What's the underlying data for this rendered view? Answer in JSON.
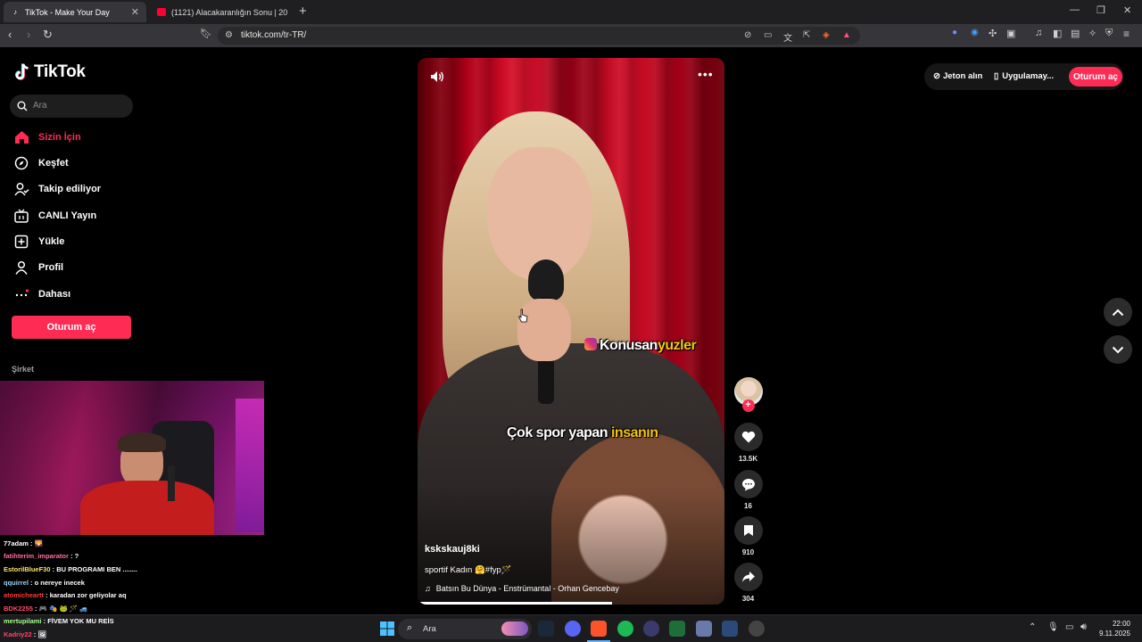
{
  "browser": {
    "tabs": [
      {
        "title": "TikTok - Make Your Day",
        "active": true
      },
      {
        "title": "(1121) Alacakaranlığın Sonu | 2025 3...",
        "active": false
      }
    ],
    "url": "tiktok.com/tr-TR/"
  },
  "tiktok": {
    "logo": "TikTok",
    "search_placeholder": "Ara",
    "nav": [
      {
        "label": "Sizin İçin",
        "icon": "home-icon",
        "active": true
      },
      {
        "label": "Keşfet",
        "icon": "compass-icon"
      },
      {
        "label": "Takip ediliyor",
        "icon": "following-icon"
      },
      {
        "label": "CANLI Yayın",
        "icon": "live-tv-icon"
      },
      {
        "label": "Yükle",
        "icon": "upload-icon"
      },
      {
        "label": "Profil",
        "icon": "profile-icon"
      },
      {
        "label": "Dahası",
        "icon": "more-icon"
      }
    ],
    "login_button": "Oturum aç",
    "company_label": "Şirket",
    "top_right": {
      "coins": "Jeton alın",
      "app": "Uygulamay...",
      "login": "Oturum aç"
    },
    "video": {
      "subtitle_1_white": "Konusan",
      "subtitle_1_yellow": "yuzler",
      "subtitle_2_white": "Çok spor yapan ",
      "subtitle_2_yellow": "insanın",
      "username": "kskskauj8ki",
      "description": "sportif Kadın 🤗#fyp🪄",
      "music": "Batsın Bu Dünya - Enstrümantal - Orhan Gencebay",
      "likes": "13.5K",
      "comments": "16",
      "saves": "910",
      "shares": "304"
    }
  },
  "chat": [
    {
      "user": "77adam",
      "msg": "🌄",
      "color": "#ffffff"
    },
    {
      "user": "fatihterim_imparator",
      "msg": "?",
      "color": "#ff6fa0"
    },
    {
      "user": "EstorilBlueF30",
      "msg": "BU PROGRAMI BEN ........",
      "color": "#ffe26b"
    },
    {
      "user": "qquirrel",
      "msg": "o nereye inecek",
      "color": "#9ad7ff"
    },
    {
      "user": "atomicheartt",
      "msg": "karadan zor geliyolar aq",
      "color": "#ff3b3b"
    },
    {
      "user": "BDK2255",
      "msg": "🎮 🎭 🐸 🪄 🚙",
      "color": "#ff4d6d"
    },
    {
      "user": "mertupilami",
      "msg": "FİVEM YOK MU REİS",
      "color": "#a6ff8a"
    },
    {
      "user": "Kadriy22",
      "msg": "🖼",
      "color": "#ff4466"
    }
  ],
  "taskbar": {
    "search": "Ara",
    "time": "22:00",
    "date": "9.11.2025"
  }
}
